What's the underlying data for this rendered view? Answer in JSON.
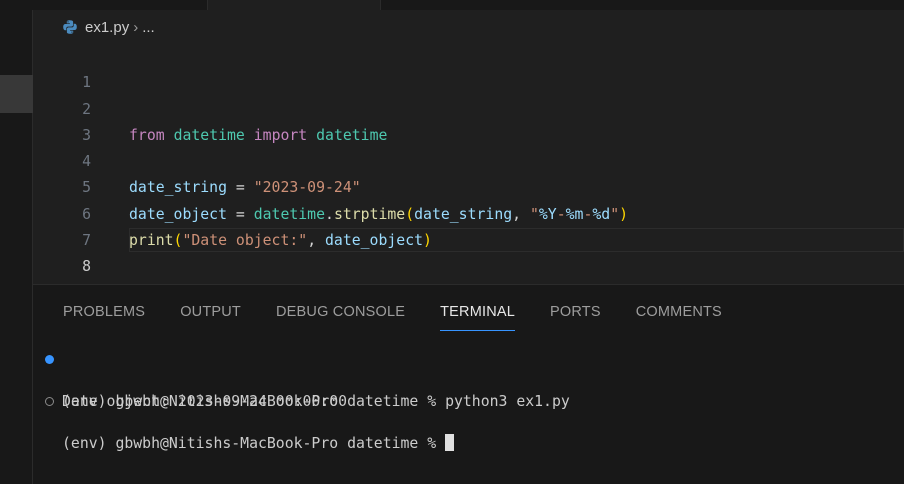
{
  "breadcrumb": {
    "file": "ex1.py",
    "separator": "›",
    "more": "..."
  },
  "editor": {
    "lines": [
      {
        "n": "1"
      },
      {
        "n": "2",
        "t": [
          "from",
          " ",
          "datetime",
          " ",
          "import",
          " ",
          "datetime"
        ]
      },
      {
        "n": "3"
      },
      {
        "n": "4",
        "t": [
          "date_string",
          " = ",
          "\"2023-09-24\""
        ]
      },
      {
        "n": "5",
        "t": [
          "date_object",
          " = ",
          "datetime",
          ".",
          "strptime",
          "(",
          "date_string",
          ", ",
          "\"",
          "%Y",
          "-",
          "%m",
          "-",
          "%d",
          "\"",
          ")"
        ]
      },
      {
        "n": "6",
        "t": [
          "print",
          "(",
          "\"Date object:\"",
          ", ",
          "date_object",
          ")"
        ]
      },
      {
        "n": "7"
      },
      {
        "n": "8"
      }
    ]
  },
  "panel": {
    "tabs": [
      "PROBLEMS",
      "OUTPUT",
      "DEBUG CONSOLE",
      "TERMINAL",
      "PORTS",
      "COMMENTS"
    ],
    "active_tab": "TERMINAL"
  },
  "terminal": {
    "lines": [
      "(env) gbwbh@Nitishs-MacBook-Pro datetime % python3 ex1.py",
      "Date object: 2023-09-24 00:00:00",
      "(env) gbwbh@Nitishs-MacBook-Pro datetime % "
    ]
  },
  "colors": {
    "keyword": "#c586c0",
    "class": "#4ec9b0",
    "variable": "#9cdcfe",
    "function": "#dcdcaa",
    "string": "#ce9178",
    "accent": "#3794ff"
  }
}
